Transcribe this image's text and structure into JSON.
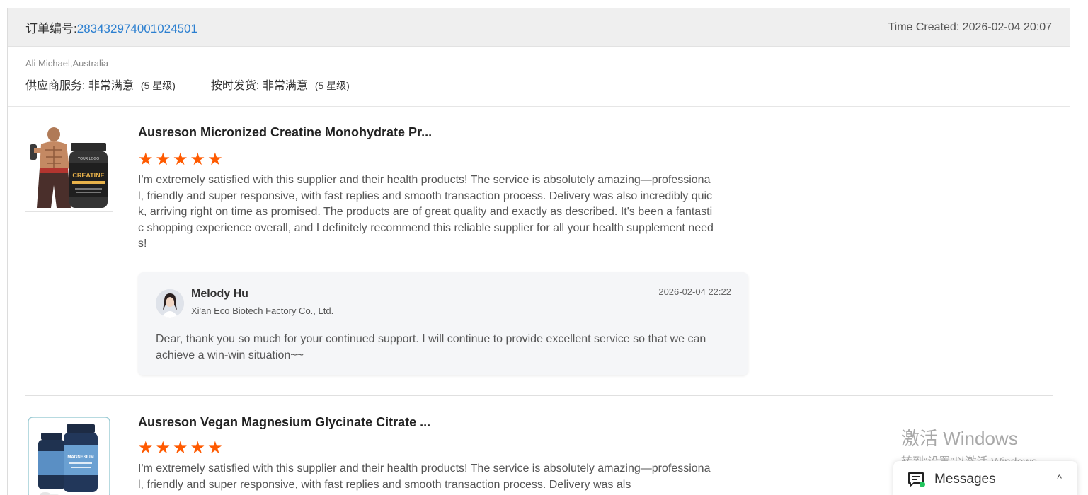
{
  "order": {
    "label": "订单编号:",
    "number": "283432974001024501",
    "time_created": "Time Created: 2026-02-04 20:07"
  },
  "buyer": {
    "name": "Ali Michael,Australia",
    "ratings": [
      {
        "label": "供应商服务:",
        "value": "非常满意",
        "level": "(5 星级)"
      },
      {
        "label": "按时发货:",
        "value": "非常满意",
        "level": "(5 星级)"
      }
    ]
  },
  "reviews": [
    {
      "title": "Ausreson Micronized Creatine Monohydrate Pr...",
      "stars": 5,
      "text": "I'm extremely satisfied with this supplier and their health products! The service is absolutely amazing—professional, friendly and super responsive, with fast replies and smooth transaction process. Delivery was also incredibly quick, arriving right on time as promised. The products are of great quality and exactly as described. It's been a fantastic shopping experience overall, and I definitely recommend this reliable supplier for all your health supplement needs!",
      "reply": {
        "name": "Melody Hu",
        "company": "Xi'an Eco Biotech Factory Co., Ltd.",
        "date": "2026-02-04 22:22",
        "text": "Dear, thank you so much for your continued support. I will continue to provide excellent service so that we can achieve a win-win situation~~"
      }
    },
    {
      "title": "Ausreson Vegan Magnesium Glycinate Citrate ...",
      "stars": 5,
      "text": "I'm extremely satisfied with this supplier and their health products! The service is absolutely amazing—professional, friendly and super responsive, with fast replies and smooth transaction process. Delivery was als"
    }
  ],
  "product_images": {
    "creatine_label": "CREATINE",
    "magnesium_label": "MAGNESIUM"
  },
  "watermark": {
    "title": "激活 Windows",
    "subtitle": "转到“设置”以激活 Windows。"
  },
  "messages": {
    "label": "Messages",
    "chevron": "^"
  },
  "colors": {
    "star": "#ff5a00",
    "link": "#2b7fd0",
    "online": "#22c55e"
  }
}
